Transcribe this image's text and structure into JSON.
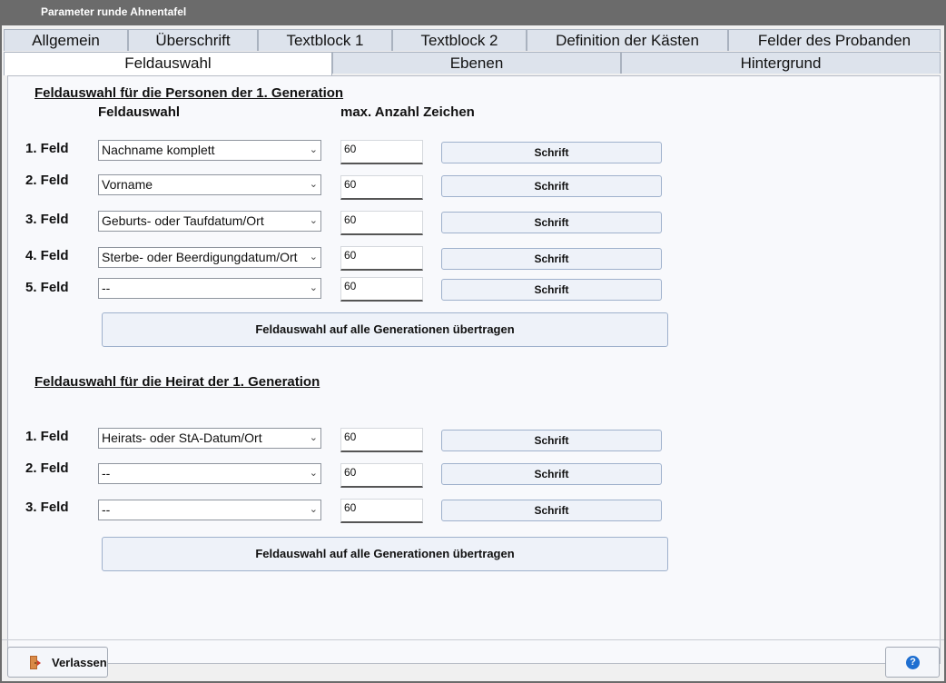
{
  "window": {
    "title": "Parameter runde Ahnentafel"
  },
  "tabs_row1": [
    "Allgemein",
    "Überschrift",
    "Textblock 1",
    "Textblock 2",
    "Definition der Kästen",
    "Felder des Probanden"
  ],
  "tabs_row2": [
    "Feldauswahl",
    "Ebenen",
    "Hintergrund"
  ],
  "persons": {
    "title": "Feldauswahl für die Personen der 1. Generation",
    "col_field": "Feldauswahl",
    "col_max": "max. Anzahl Zeichen",
    "rows": [
      {
        "label": "1. Feld",
        "value": "Nachname komplett",
        "max": "60",
        "button": "Schrift"
      },
      {
        "label": "2. Feld",
        "value": "Vorname",
        "max": "60",
        "button": "Schrift"
      },
      {
        "label": "3. Feld",
        "value": "Geburts- oder Taufdatum/Ort",
        "max": "60",
        "button": "Schrift"
      },
      {
        "label": "4. Feld",
        "value": "Sterbe- oder Beerdigungdatum/Ort",
        "max": "60",
        "button": "Schrift"
      },
      {
        "label": "5. Feld",
        "value": "--",
        "max": "60",
        "button": "Schrift"
      }
    ],
    "apply_button": "Feldauswahl auf alle Generationen übertragen"
  },
  "marriage": {
    "title": "Feldauswahl für die Heirat der 1. Generation",
    "rows": [
      {
        "label": "1. Feld",
        "value": "Heirats- oder StA-Datum/Ort",
        "max": "60",
        "button": "Schrift"
      },
      {
        "label": "2. Feld",
        "value": "--",
        "max": "60",
        "button": "Schrift"
      },
      {
        "label": "3. Feld",
        "value": "--",
        "max": "60",
        "button": "Schrift"
      }
    ],
    "apply_button": "Feldauswahl auf alle Generationen übertragen"
  },
  "footer": {
    "exit_label": "Verlassen",
    "exit_icon": "exit-door-icon",
    "help_icon": "help-icon"
  },
  "colors": {
    "tab_bg": "#dde3ec",
    "button_bg": "#eef2f9",
    "button_border": "#9fb1cc",
    "help_blue": "#1e6fd1"
  }
}
